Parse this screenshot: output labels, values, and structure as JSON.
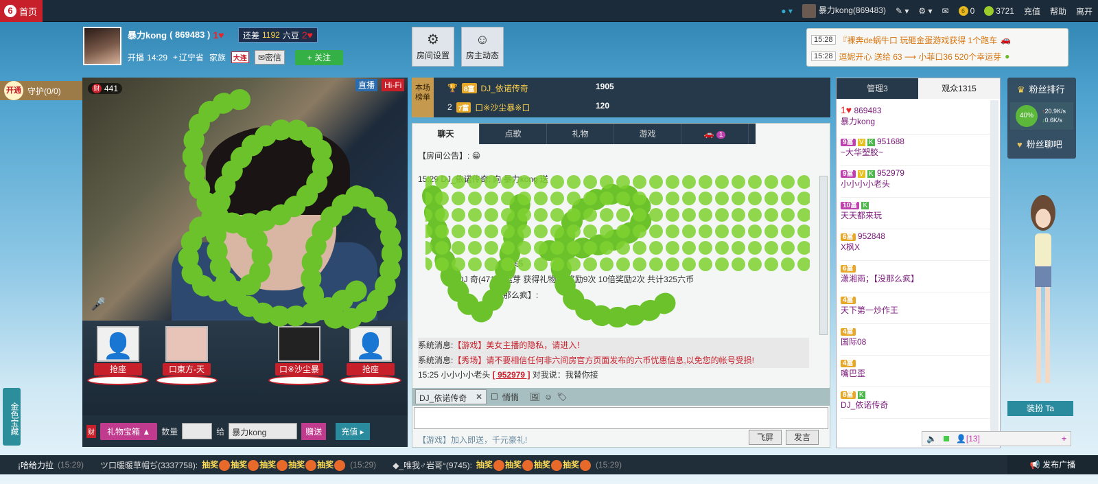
{
  "top": {
    "home": "首页",
    "user": "暴力kong(869483)",
    "coins": "0",
    "beans": "3721",
    "recharge": "充值",
    "help": "帮助",
    "exit": "离开"
  },
  "host": {
    "name": "暴力kong",
    "id": "( 869483 )",
    "gap_label": "还差",
    "gap_value": "1192",
    "gap_unit": "六豆",
    "live_label": "开播",
    "live_time": "14:29",
    "province": "辽宁省",
    "family_label": "家族",
    "family_tag": "大连",
    "private_msg": "密信",
    "follow": "+ 关注"
  },
  "room_buttons": {
    "settings": "房间设置",
    "dynamics": "房主动态"
  },
  "notice": [
    {
      "time": "15:28",
      "text": "『裸奔de蜗牛口 玩砸金蛋游戏获得 1个跑车"
    },
    {
      "time": "15:28",
      "text": "逗妮开心 送给 63 ⟶ 小菲口36 520个幸运芽"
    }
  ],
  "guard": {
    "open": "开通",
    "label": "守护(0/0)"
  },
  "side_game": "金色宝藏",
  "video": {
    "viewers": "441",
    "live": "直播",
    "hifi": "Hi-Fi"
  },
  "seats": [
    {
      "label": "抢座"
    },
    {
      "label": "口東方-天"
    },
    {
      "label": "口※沙尘暴"
    },
    {
      "label": "抢座"
    }
  ],
  "gift": {
    "box": "礼物宝箱",
    "qty_label": "数量",
    "to_label": "给",
    "to_user": "暴力kong",
    "send": "赠送",
    "recharge": "充值"
  },
  "rank": {
    "title": "本场榜单",
    "rows": [
      {
        "pos": "1",
        "lvl": "8富",
        "name": "DJ_依诺传奇",
        "value": "1905"
      },
      {
        "pos": "2",
        "lvl": "7富",
        "name": "口※沙尘暴※口",
        "value": "120"
      }
    ]
  },
  "chat": {
    "tabs": [
      "聊天",
      "点歌",
      "礼物",
      "游戏",
      "1"
    ],
    "announce": "【房间公告】:",
    "messages": [
      "15:29 DJ_依诺传奇: 向 暴力kong 送",
      ", 共5",
      "DJ     奇(4719)      运芽 获得礼物      倍奖励9次 10倍奖励2次 共计325六币",
      "【没那么疯】:"
    ],
    "sys_label": "系统消息:",
    "sys1": "【游戏】美女主播的隐私，请进入！",
    "sys2": "【秀场】请不要相信任何非六间房官方页面发布的六币忧惠信息,以免您的帐号受损!",
    "pm_time": "15:25",
    "pm_user": "小小小小老头",
    "pm_id": "[ 952979 ]",
    "pm_text": "对我说：我替你接",
    "target": "DJ_依诺传奇",
    "quiet": "悄悄",
    "promo": "【游戏】加入即送，千元豪礼!",
    "fly": "飞屏",
    "send": "发言"
  },
  "users": {
    "tab_admin": "管理3",
    "tab_audience": "观众1315",
    "list": [
      {
        "lvl": "",
        "id": "869483",
        "name": "暴力kong"
      },
      {
        "lvl": "9富",
        "id": "951688",
        "name": "~大华塑胶~"
      },
      {
        "lvl": "9富",
        "id": "952979",
        "name": "小小小小老头"
      },
      {
        "lvl": "10富",
        "id": "",
        "name": "天天都来玩"
      },
      {
        "lvl": "6富",
        "id": "952848",
        "name": "X枫X"
      },
      {
        "lvl": "6富",
        "id": "",
        "name": "潇湘雨；【没那么疯】"
      },
      {
        "lvl": "4富",
        "id": "",
        "name": "天下第一炒作王"
      },
      {
        "lvl": "4富",
        "id": "",
        "name": "国际08"
      },
      {
        "lvl": "4富",
        "id": "",
        "name": "嘴巴歪"
      },
      {
        "lvl": "8富",
        "id": "",
        "name": "DJ_依诺传奇"
      }
    ]
  },
  "right": {
    "fans_rank": "粉丝排行",
    "percent": "40%",
    "up": "20.9K/s",
    "down": "0.6K/s",
    "fans_bar": "粉丝聊吧",
    "dress": "装扮 Ta",
    "count": "[13]"
  },
  "bottom": {
    "lead": "¡哈给力拉",
    "t1": "(15:29)",
    "u1": "ツ口暖暖草帽ぢ(3337758):",
    "lottery": "抽奖",
    "t2": "(15:29)",
    "u2": "◆_唯我♂岩哥°(9745):",
    "t3": "(15:29)",
    "publish": "发布广播"
  }
}
